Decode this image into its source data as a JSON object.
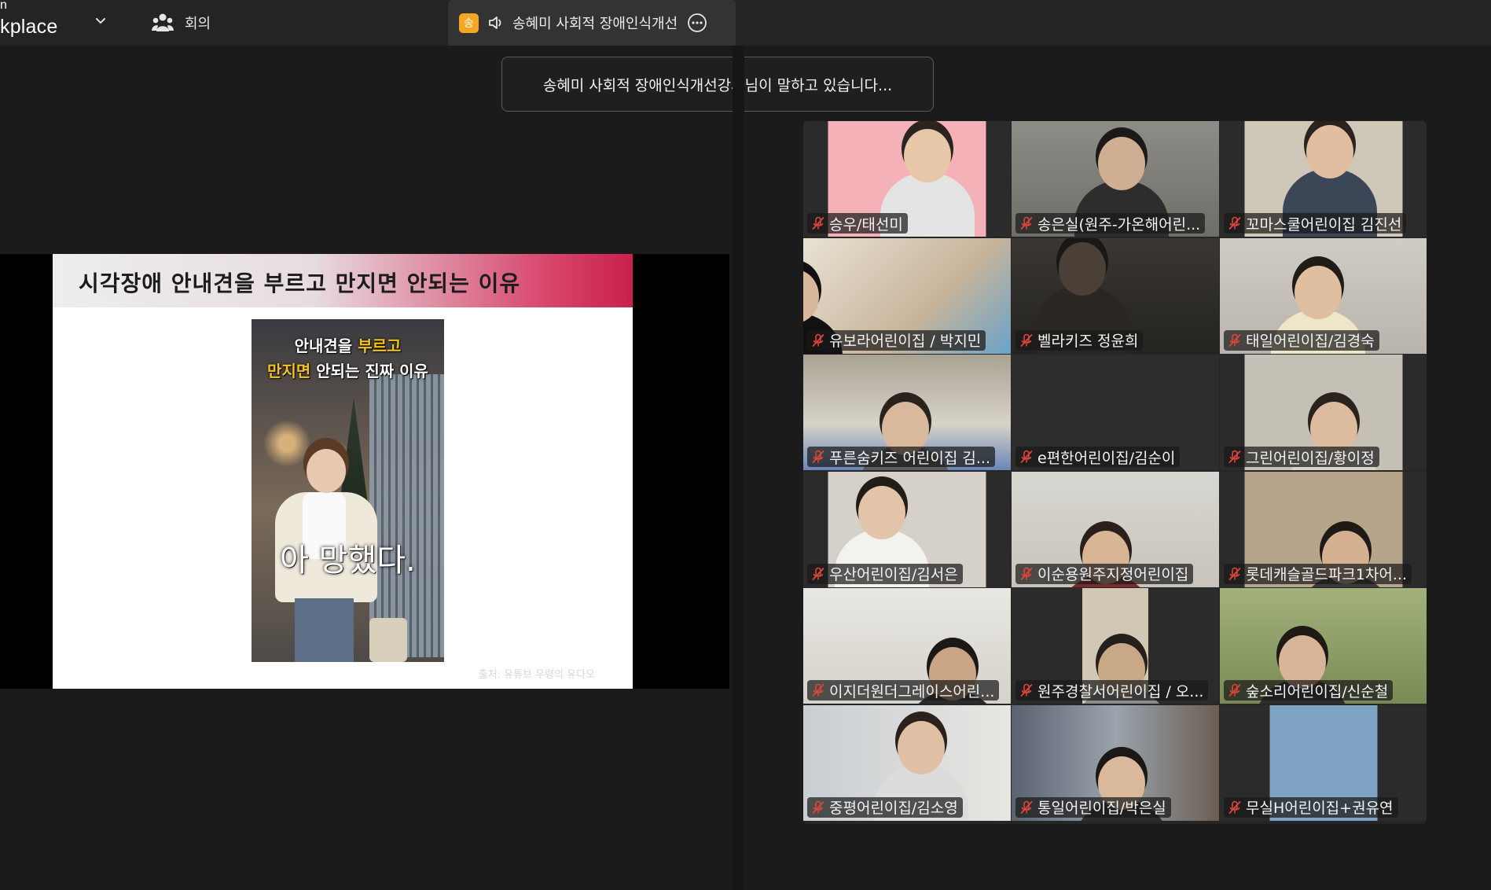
{
  "app": {
    "brand_small": "n",
    "brand_main": "kplace"
  },
  "toolbar": {
    "meeting_label": "회의"
  },
  "active_tab": {
    "badge": "송",
    "title": "송혜미 사회적 장애인식개선"
  },
  "toast": {
    "text": "송혜미 사회적 장애인식개선강사님이 말하고 있습니다..."
  },
  "slide": {
    "title": "시각장애 안내견을 부르고 만지면 안되는 이유",
    "video_caption_line1_a": "안내견을 ",
    "video_caption_line1_b": "부르고",
    "video_caption_line2_a": "만지면",
    "video_caption_line2_b": " 안되는 진짜 이유",
    "video_subtitle": "아 망했다.",
    "source": "출처: 유튜브 우령의 유다오"
  },
  "participants": [
    {
      "name": "승우/태선미"
    },
    {
      "name": "송은실(원주-가온해어린..."
    },
    {
      "name": "꼬마스쿨어린이집 김진선"
    },
    {
      "name": "유보라어린이집 / 박지민"
    },
    {
      "name": "벨라키즈 정윤희"
    },
    {
      "name": "태일어린이집/김경숙"
    },
    {
      "name": "푸른숨키즈 어린이집 김..."
    },
    {
      "name": "e편한어린이집/김순이"
    },
    {
      "name": "그린어린이집/황이정"
    },
    {
      "name": "우산어린이집/김서은"
    },
    {
      "name": "이순용원주지정어린이집"
    },
    {
      "name": "롯데캐슬골드파크1차어..."
    },
    {
      "name": "이지더원더그레이스어린..."
    },
    {
      "name": "원주경찰서어린이집 / 오..."
    },
    {
      "name": "숲소리어린이집/신순철"
    },
    {
      "name": "중평어린이집/김소영"
    },
    {
      "name": "통일어린이집/박은실"
    },
    {
      "name": "무실H어린이집+권유연"
    }
  ],
  "colors": {
    "accent_orange": "#f5a623",
    "mic_muted": "#e0443a"
  }
}
